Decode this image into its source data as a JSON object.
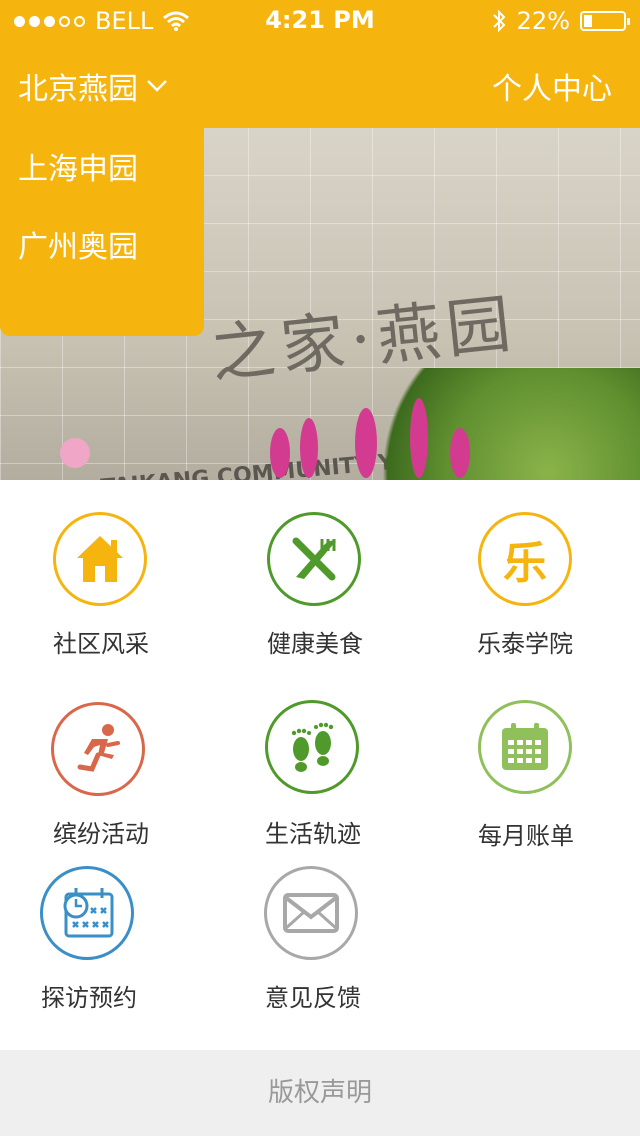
{
  "status_bar": {
    "carrier": "BELL",
    "time": "4:21 PM",
    "battery_percent": "22%",
    "battery_level": 0.22
  },
  "navbar": {
    "city": "北京燕园",
    "personal_center": "个人中心"
  },
  "dropdown": {
    "options": [
      "上海申园",
      "广州奥园"
    ]
  },
  "hero": {
    "sign_cn": "之家·燕园",
    "sign_en": "TAIKANG COMMUNITY   YAN GARD"
  },
  "grid": {
    "items": [
      {
        "label": "社区风采",
        "icon": "home-icon",
        "color": "#f6b40f"
      },
      {
        "label": "健康美食",
        "icon": "fork-knife-icon",
        "color": "#4f9a2a"
      },
      {
        "label": "乐泰学院",
        "icon": "le-character-icon",
        "glyph": "乐",
        "color": "#f6b40f"
      },
      {
        "label": "缤纷活动",
        "icon": "running-person-icon",
        "color": "#d9684a"
      },
      {
        "label": "生活轨迹",
        "icon": "footprints-icon",
        "color": "#4f9a2a"
      },
      {
        "label": "每月账单",
        "icon": "calendar-icon",
        "color": "#8fc05a"
      },
      {
        "label": "探访预约",
        "icon": "schedule-icon",
        "color": "#3a8fc6"
      },
      {
        "label": "意见反馈",
        "icon": "envelope-icon",
        "color": "#a8a8a8"
      }
    ]
  },
  "footer": {
    "copyright": "版权声明"
  }
}
